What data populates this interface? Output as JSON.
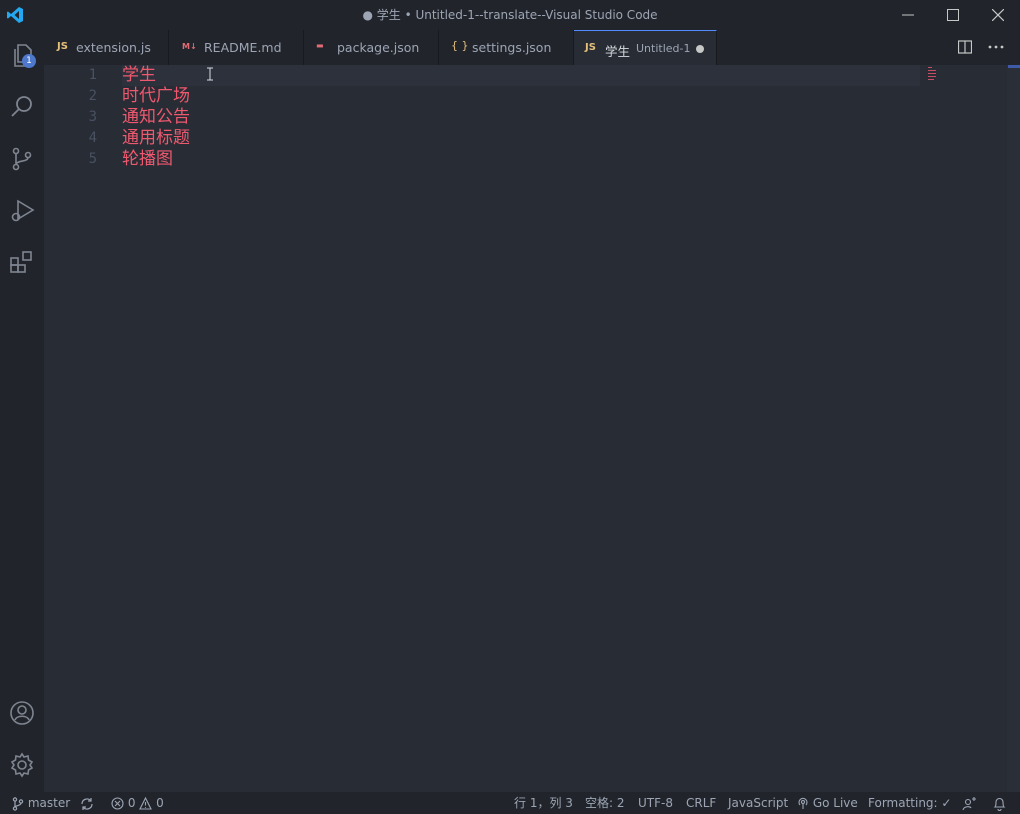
{
  "window": {
    "title": "● 学生 • Untitled-1--translate--Visual Studio Code"
  },
  "activity": {
    "explorer_badge": "1",
    "items": [
      "files-icon",
      "search-icon",
      "source-control-icon",
      "run-debug-icon",
      "extensions-icon",
      "account-icon",
      "settings-gear-icon"
    ]
  },
  "tabs": [
    {
      "icon": "JS",
      "label": "extension.js",
      "type": "js"
    },
    {
      "icon": "M↓",
      "label": "README.md",
      "type": "md"
    },
    {
      "icon": "▬",
      "label": "package.json",
      "type": "npm"
    },
    {
      "icon": "{ }",
      "label": "settings.json",
      "type": "json"
    },
    {
      "icon": "JS",
      "label": "学生",
      "description": "Untitled-1",
      "type": "js",
      "active": true,
      "dirty": true
    }
  ],
  "editor": {
    "lines": [
      {
        "number": "1",
        "text": "学生"
      },
      {
        "number": "2",
        "text": "时代广场"
      },
      {
        "number": "3",
        "text": "通知公告"
      },
      {
        "number": "4",
        "text": "通用标题"
      },
      {
        "number": "5",
        "text": "轮播图"
      }
    ],
    "text_color": "#ef596f"
  },
  "statusbar": {
    "branch": "master",
    "errors": "0",
    "warnings": "0",
    "position": "行 1，列 3",
    "spaces": "空格: 2",
    "encoding": "UTF-8",
    "eol": "CRLF",
    "language": "JavaScript",
    "golive": "Go Live",
    "formatting": "Formatting: ✓"
  },
  "colors": {
    "accent": "#528bff",
    "badge": "#4d78cc",
    "editor_bg": "#282c34",
    "chrome_bg": "#21252b"
  }
}
